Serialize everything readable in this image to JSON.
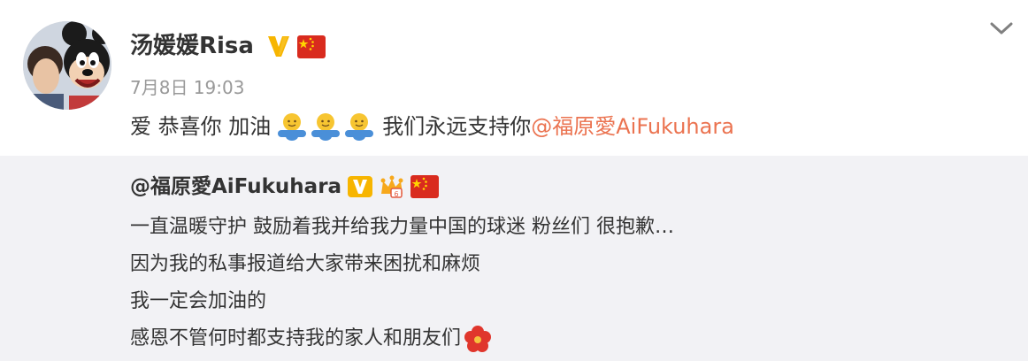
{
  "post": {
    "author": "汤媛媛Risa",
    "timestamp": "7月8日 19:03",
    "text_part1": "爱 恭喜你  加油",
    "text_part2": "我们永远支持你",
    "mention": "@福原愛AiFukuhara",
    "icons": [
      "verified-v-icon",
      "china-flag-icon",
      "hug-emoji-icon",
      "chevron-down-icon"
    ]
  },
  "repost": {
    "author": "@福原愛AiFukuhara",
    "lines": [
      "一直温暖守护 鼓励着我并给我力量中国的球迷 粉丝们 很抱歉…",
      "因为我的私事报道给大家带来困扰和麻烦",
      "我一定会加油的",
      "感恩不管何时都支持我的家人和朋友们"
    ],
    "icons": [
      "verified-v-icon",
      "crown-icon",
      "china-flag-icon",
      "flower-icon"
    ]
  },
  "colors": {
    "mention": "#eb7350",
    "verify": "#f7b500",
    "repost_bg": "#f2f2f5",
    "timestamp": "#999999"
  }
}
